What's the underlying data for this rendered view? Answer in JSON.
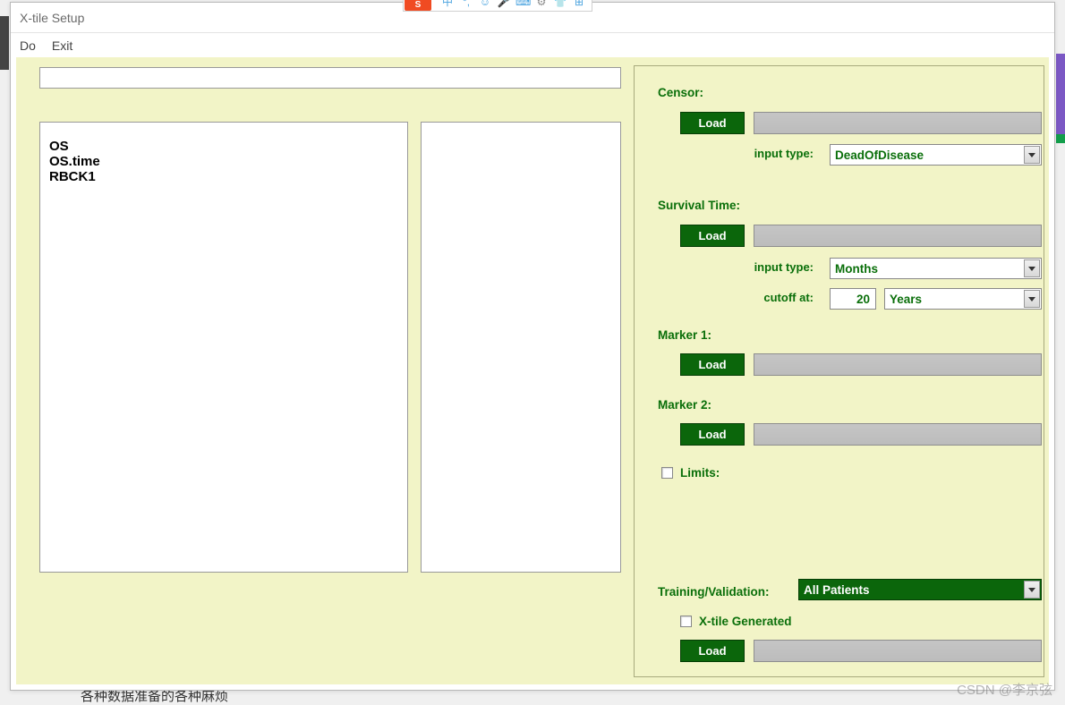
{
  "window": {
    "title": "X-tile Setup"
  },
  "menu": {
    "do": "Do",
    "exit": "Exit"
  },
  "listbox_left": [
    "OS",
    "OS.time",
    "RBCK1"
  ],
  "panel": {
    "censor": {
      "label": "Censor:",
      "load": "Load",
      "input_type_label": "input type:",
      "input_type_value": "DeadOfDisease"
    },
    "survival": {
      "label": "Survival Time:",
      "load": "Load",
      "input_type_label": "input type:",
      "input_type_value": "Months",
      "cutoff_label": "cutoff at:",
      "cutoff_value": "20",
      "cutoff_unit": "Years"
    },
    "marker1": {
      "label": "Marker 1:",
      "load": "Load"
    },
    "marker2": {
      "label": "Marker 2:",
      "load": "Load"
    },
    "limits": {
      "label": "Limits:"
    },
    "trainval": {
      "label": "Training/Validation:",
      "value": "All Patients",
      "xtile_gen_label": "X-tile Generated",
      "load": "Load"
    }
  },
  "toolbar_icons": [
    "中",
    "°,",
    "☺",
    "🎤",
    "⌨",
    "⚙",
    "👕",
    "⊞"
  ],
  "sogou": "S",
  "watermark": "CSDN @李京弦",
  "bottom_fragment": "各种数据准备的各种麻烦"
}
